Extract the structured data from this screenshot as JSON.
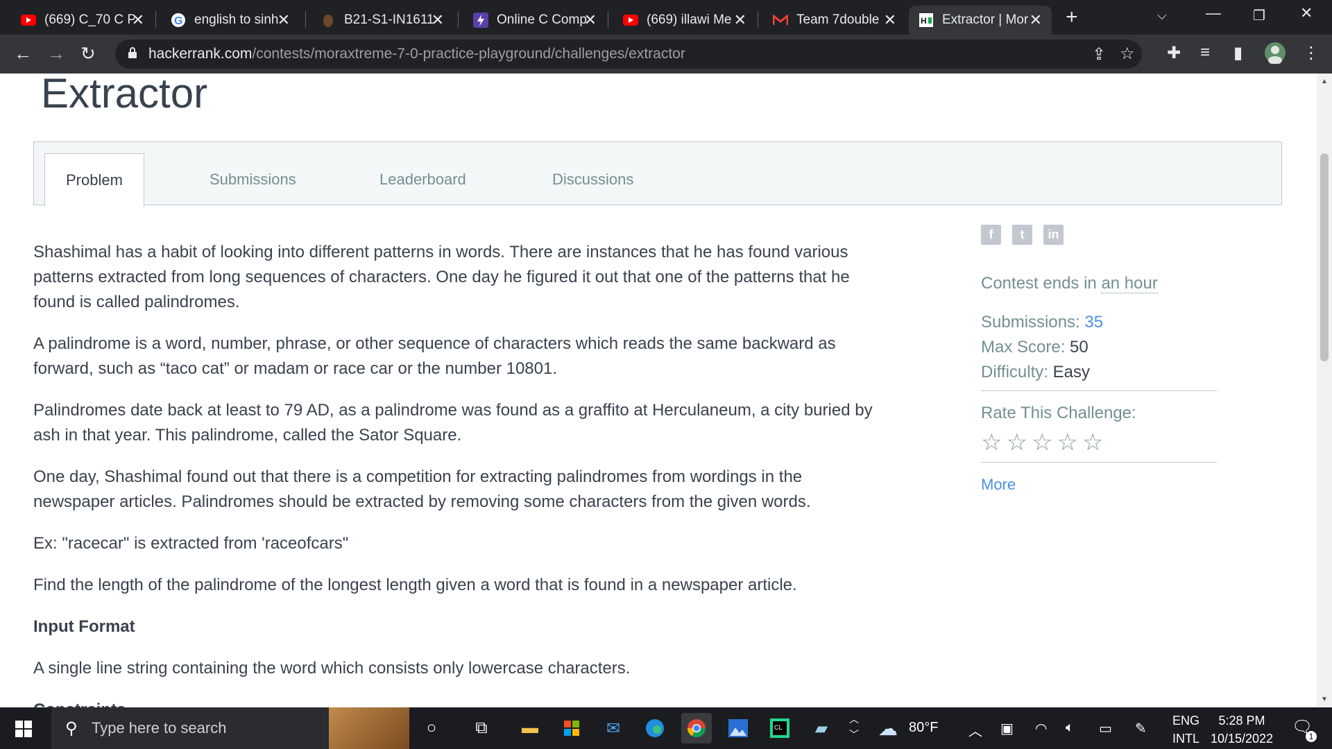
{
  "browser": {
    "tabs": [
      {
        "title": "(669) C_70 C Pr",
        "icon": "youtube-icon"
      },
      {
        "title": "english to sinh",
        "icon": "google-icon"
      },
      {
        "title": "B21-S1-IN1611",
        "icon": "moodle-icon"
      },
      {
        "title": "Online C Comp",
        "icon": "onlinegdb-icon"
      },
      {
        "title": "(669) illawi Me",
        "icon": "youtube-icon"
      },
      {
        "title": "Team 7double",
        "icon": "gmail-icon"
      },
      {
        "title": "Extractor | Mor",
        "icon": "hackerrank-icon",
        "active": true
      }
    ],
    "url_host": "hackerrank.com",
    "url_path": "/contests/moraxtreme-7-0-practice-playground/challenges/extractor"
  },
  "page": {
    "title": "Extractor",
    "tabs": [
      "Problem",
      "Submissions",
      "Leaderboard",
      "Discussions"
    ],
    "paragraphs": [
      "Shashimal has a habit of looking into different patterns in words. There are instances that he has found various patterns extracted from long sequences of characters. One day he figured it out that one of the patterns that he found is called palindromes.",
      "A palindrome is a word, number, phrase, or other sequence of characters which reads the same backward as forward, such as “taco cat” or madam or race car or the number 10801.",
      "Palindromes date back at least to 79 AD, as a palindrome was found as a graffito at Herculaneum, a city buried by ash in that year. This palindrome, called the Sator Square.",
      "One day, Shashimal found out that there is a competition for extracting palindromes from wordings in the newspaper articles. Palindromes should be extracted by removing some characters from the given words.",
      "Ex: \"racecar\" is extracted from 'raceofcars\"",
      "Find the length of the palindrome of the longest length given a word that is found in a newspaper article."
    ],
    "input_heading": "Input Format",
    "input_text": "A single line string containing the word which consists only lowercase characters.",
    "constraints_heading": "Constraints"
  },
  "sidebar": {
    "contest_ends_label": "Contest ends in ",
    "contest_ends_value": "an hour",
    "submissions_label": "Submissions: ",
    "submissions_value": "35",
    "max_score_label": "Max Score: ",
    "max_score_value": "50",
    "difficulty_label": "Difficulty: ",
    "difficulty_value": "Easy",
    "rate_label": "Rate This Challenge:",
    "more_label": "More",
    "rating": 0
  },
  "taskbar": {
    "search_placeholder": "Type here to search",
    "weather": "80°F",
    "lang_top": "ENG",
    "lang_bottom": "INTL",
    "time": "5:28 PM",
    "date": "10/15/2022",
    "notifications": "1"
  }
}
